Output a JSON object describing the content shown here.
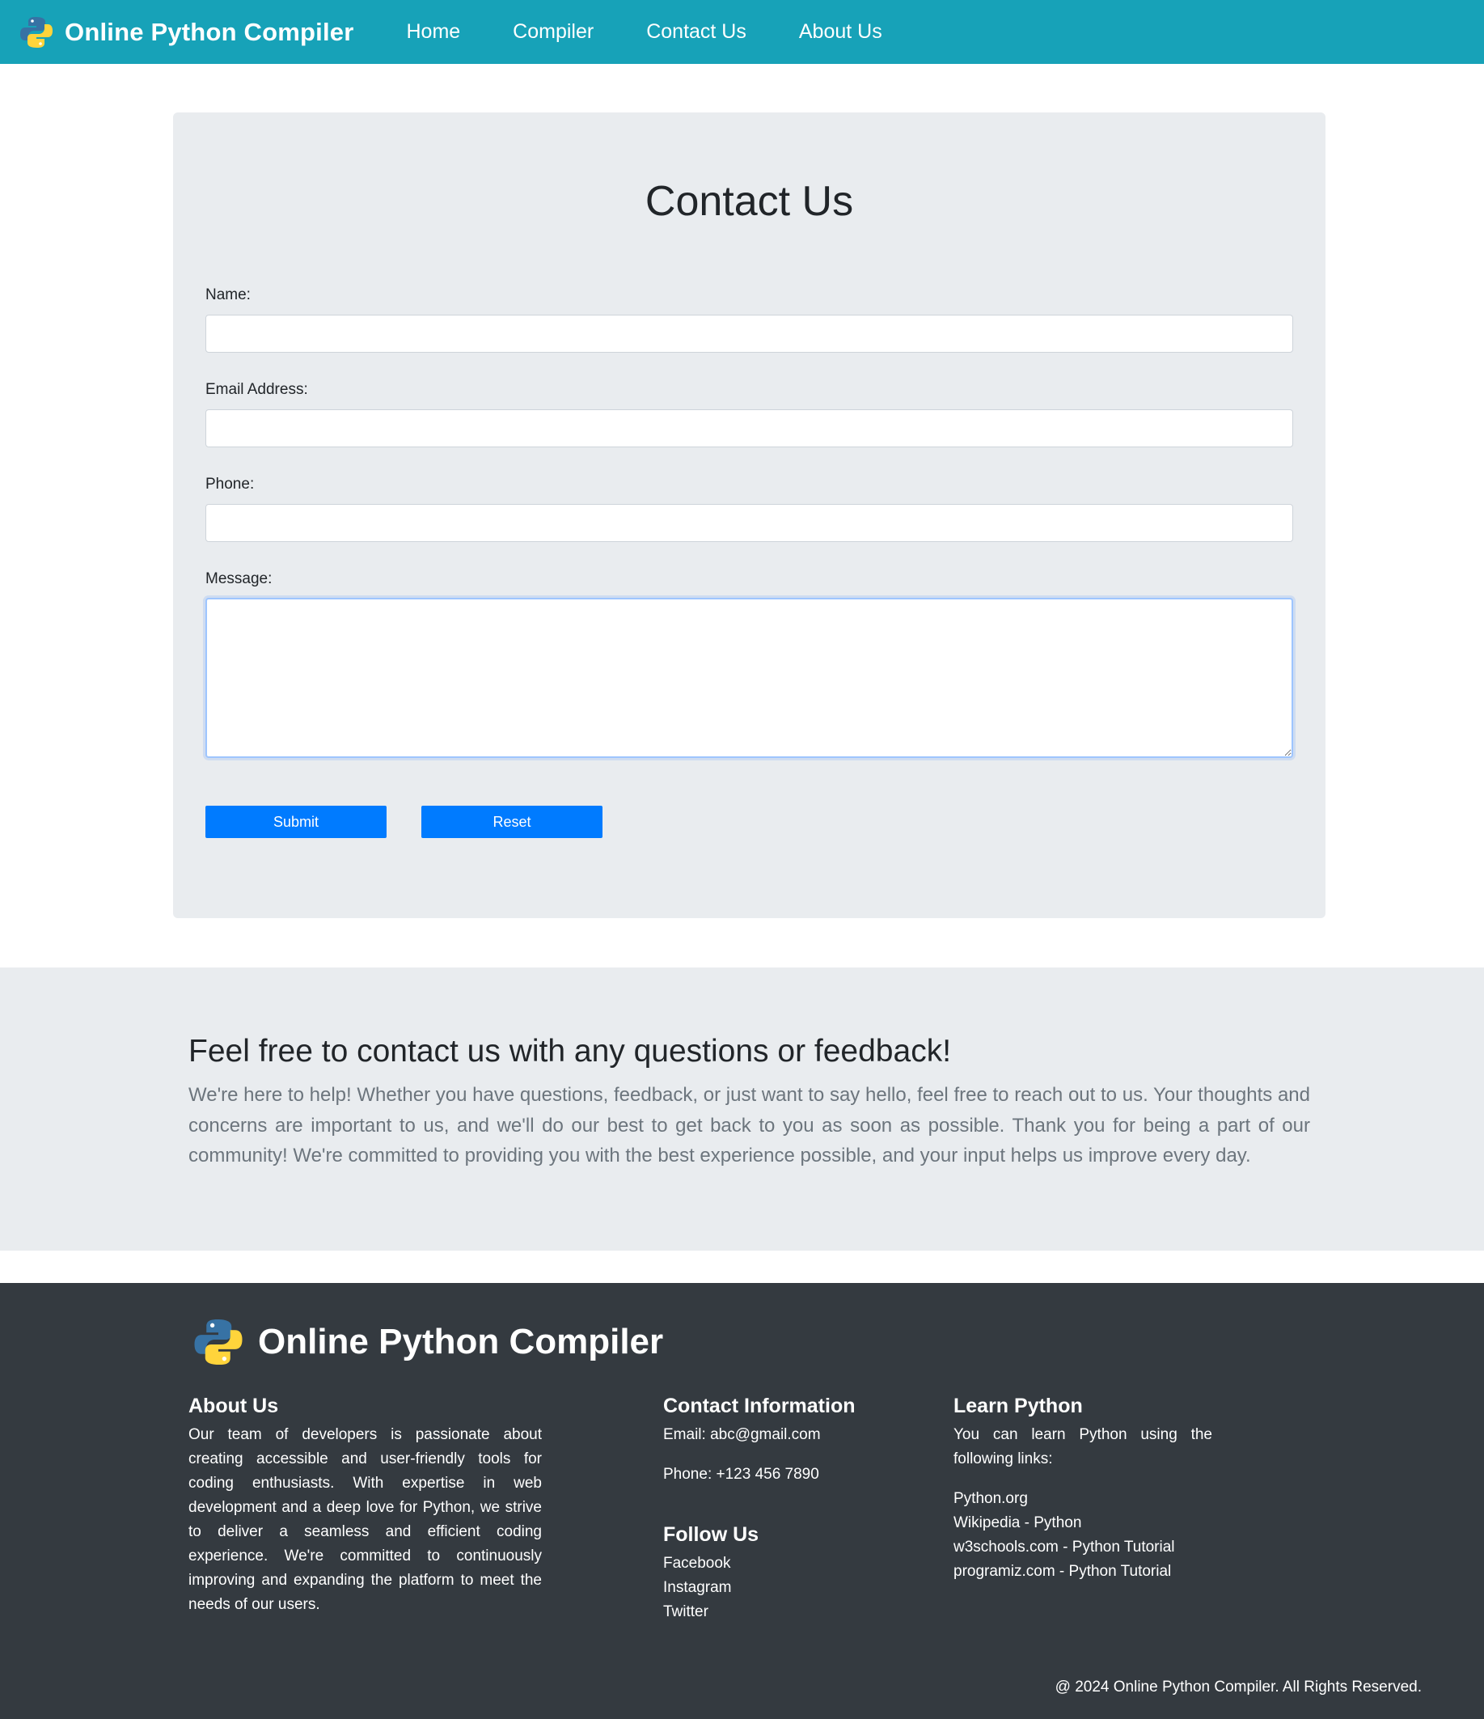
{
  "navbar": {
    "brand": "Online Python Compiler",
    "links": [
      "Home",
      "Compiler",
      "Contact Us",
      "About Us"
    ]
  },
  "form": {
    "title": "Contact Us",
    "name_label": "Name:",
    "email_label": "Email Address:",
    "phone_label": "Phone:",
    "message_label": "Message:",
    "submit_label": "Submit",
    "reset_label": "Reset"
  },
  "info": {
    "heading": "Feel free to contact us with any questions or feedback!",
    "text": "We're here to help! Whether you have questions, feedback, or just want to say hello, feel free to reach out to us. Your thoughts and concerns are important to us, and we'll do our best to get back to you as soon as possible. Thank you for being a part of our community! We're committed to providing you with the best experience possible, and your input helps us improve every day."
  },
  "footer": {
    "brand": "Online Python Compiler",
    "about": {
      "heading": "About Us",
      "text": "Our team of developers is passionate about creating accessible and user-friendly tools for coding enthusiasts. With expertise in web development and a deep love for Python, we strive to deliver a seamless and efficient coding experience. We're committed to continuously improving and expanding the platform to meet the needs of our users."
    },
    "contact": {
      "heading": "Contact Information",
      "email": "Email: abc@gmail.com",
      "phone": "Phone: +123 456 7890"
    },
    "follow": {
      "heading": "Follow Us",
      "links": [
        "Facebook",
        "Instagram",
        "Twitter"
      ]
    },
    "learn": {
      "heading": "Learn Python",
      "text": "You can learn Python using the following links:",
      "links": [
        "Python.org",
        "Wikipedia - Python",
        "w3schools.com - Python Tutorial",
        "programiz.com - Python Tutorial"
      ]
    },
    "copyright": "@ 2024 Online Python Compiler. All Rights Reserved."
  },
  "colors": {
    "navbar": "#17a2b8",
    "button": "#007bff",
    "footer": "#343a40",
    "panel": "#e9ecef"
  },
  "icons": [
    "python-logo-icon"
  ]
}
